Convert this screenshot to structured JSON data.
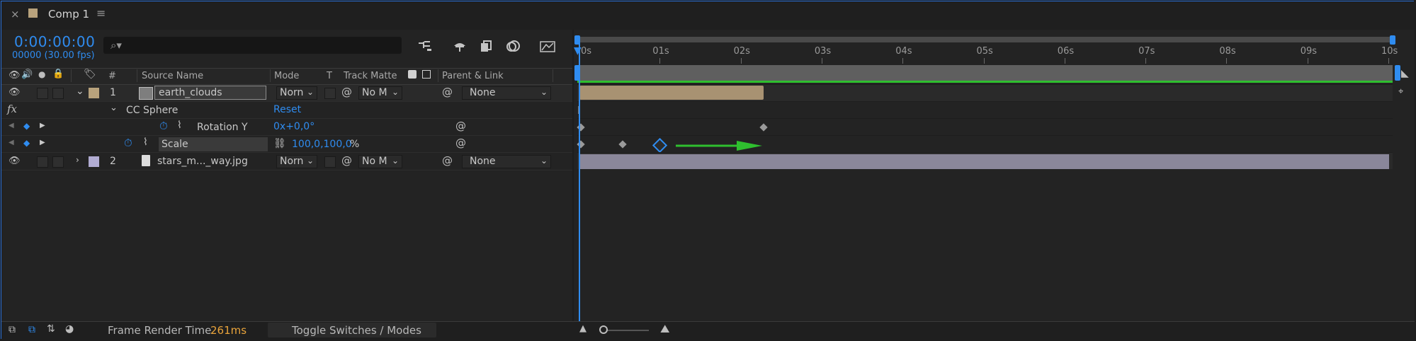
{
  "tab": {
    "title": "Comp 1",
    "close_icon": "×",
    "menu_icon": "≡",
    "swatch_color": "#b8a27c"
  },
  "time": {
    "timecode": "0:00:00:00",
    "frames": "00000 (30.00 fps)"
  },
  "search": {
    "placeholder": "",
    "icon": "search-icon"
  },
  "columns": {
    "num": "#",
    "source_name": "Source Name",
    "mode": "Mode",
    "t": "T",
    "track_matte": "Track Matte",
    "parent_link": "Parent & Link"
  },
  "layers": [
    {
      "index": "1",
      "name": "earth_clouds",
      "mode": "Norn",
      "matte": "No M",
      "parent": "None",
      "label_color": "#b8a27c"
    },
    {
      "index": "2",
      "name": "stars_m..._way.jpg",
      "mode": "Norn",
      "matte": "No M",
      "parent": "None",
      "label_color": "#b1acd2"
    }
  ],
  "effect": {
    "fx_label": "fx",
    "name": "CC Sphere",
    "reset": "Reset",
    "rotation_label": "Rotation Y",
    "rotation_value": "0x+0,0°",
    "scale_label": "Scale",
    "scale_value": "100,0,100,0",
    "scale_unit": "%"
  },
  "ruler": {
    "labels": [
      "0s",
      "01s",
      "02s",
      "03s",
      "04s",
      "05s",
      "06s",
      "07s",
      "08s",
      "09s",
      "10s"
    ]
  },
  "bottom": {
    "frame_render_label": "Frame Render Time",
    "frame_render_value": "261ms",
    "toggle_label": "Toggle Switches / Modes"
  },
  "colors": {
    "accent": "#2f8cf0",
    "green": "#2fbf2f",
    "value_orange": "#e8a33b"
  }
}
